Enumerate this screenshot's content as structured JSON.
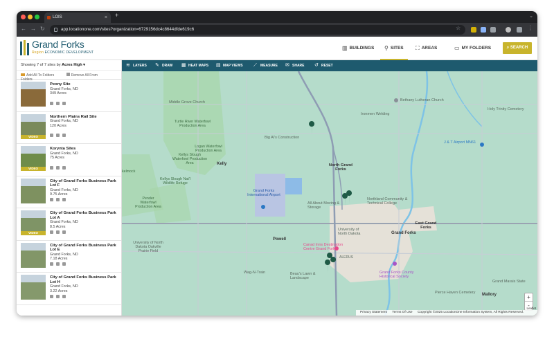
{
  "browser": {
    "tab_title": "LOIS",
    "url": "app.locationone.com/sites?organization=6729156dc4c8644dfde619c6",
    "new_tab": "+",
    "tab_close": "×"
  },
  "brand": {
    "title": "Grand Forks",
    "subtitle_region": "Region",
    "subtitle_rest": "ECONOMIC DEVELOPMENT"
  },
  "topnav": {
    "buildings": "BUILDINGS",
    "sites": "SITES",
    "areas": "AREAS",
    "folders": "MY FOLDERS",
    "search": "SEARCH"
  },
  "sidebar": {
    "showing_prefix": "Showing 7 of 7 sites by",
    "sort": "Acres High ▾",
    "add_all": "Add All To Folders",
    "remove_all": "Remove All From Folders",
    "video_label": "VIDEO",
    "sites": [
      {
        "name": "Peony Site",
        "location": "Grand Forks, ND",
        "acres": "349 Acres",
        "video": false,
        "ground": "#8a6a3a"
      },
      {
        "name": "Northern Plains Rail Site",
        "location": "Grand Forks, ND",
        "acres": "120 Acres",
        "video": true,
        "ground": "#7a8a5a"
      },
      {
        "name": "Korynta Sites",
        "location": "Grand Forks, ND",
        "acres": "75 Acres",
        "video": true,
        "ground": "#6f8c4a"
      },
      {
        "name": "City of Grand Forks Business Park Lot F",
        "location": "Grand Forks, ND",
        "acres": "9.75 Acres",
        "video": false,
        "ground": "#7e9160"
      },
      {
        "name": "City of Grand Forks Business Park Lot A",
        "location": "Grand Forks, ND",
        "acres": "8.5 Acres",
        "video": true,
        "ground": "#7f9466"
      },
      {
        "name": "City of Grand Forks Business Park Lot E",
        "location": "Grand Forks, ND",
        "acres": "7.18 Acres",
        "video": false,
        "ground": "#829668"
      },
      {
        "name": "City of Grand Forks Business Park Lot H",
        "location": "Grand Forks, ND",
        "acres": "3.22 Acres",
        "video": false,
        "ground": "#85996c"
      }
    ]
  },
  "toolbar": {
    "layers": "LAYERS",
    "draw": "DRAW",
    "heat_maps": "HEAT MAPS",
    "map_views": "MAP VIEWS",
    "measure": "MEASURE",
    "share": "SHARE",
    "reset": "RESET"
  },
  "map": {
    "labels": {
      "middle_grove": "Middle Grove Church",
      "bethany": "Bethany Lutheran Church",
      "ironmen": "Ironmen Welding",
      "holy_trinity": "Holy Trinity Cemetery",
      "turtle_river": "Turtle River Waterfowl Production Area",
      "logan": "Logan Waterfowl Production Area",
      "big_al": "Big Al's Construction",
      "jj_airport": "J & T Airport MN61",
      "kellys_slough_wpa": "Kellys Slough Waterfowl Production Area",
      "kelly": "Kelly",
      "north_grand_forks": "North Grand Forks",
      "kellys_slough_refuge": "Kellys Slough Nat'l Wildlife Refuge",
      "gf_airport": "Grand Forks International Airport",
      "all_about": "All About Moving & Storage",
      "northland": "Northland Community & Technical College",
      "pender": "Pender Waterfowl Production Area",
      "east_grand_forks": "East Grand Forks",
      "und": "University of North Dakota",
      "grand_forks": "Grand Forks",
      "powell": "Powell",
      "und_oakville": "University of North Dakota Oakville Prairie Field",
      "canad_inns": "Canad Inns Destination Centre Grand Forks",
      "alerus": "ALERUS",
      "waghntrain": "Wag-N-Train",
      "beaus": "Beau's Lawn & Landscape",
      "gf_historical": "Grand Forks County Historical Society",
      "grand_marais": "Grand Marais State",
      "pierce_haven": "Pierce Haven Cemetery",
      "mallory": "Mallory",
      "kelmock": "kelmock"
    },
    "zoom_in": "+",
    "zoom_out": "-",
    "attribution": "Leaflet"
  },
  "footer": {
    "privacy": "Privacy Statement",
    "terms": "Terms Of Use",
    "copyright": "Copyright ©2025 LocationOne Information System, All Rights Reserved."
  },
  "colors": {
    "teal": "#1e5a6e",
    "gold": "#c8b42c",
    "map_bg": "#b5dccb",
    "pin": "#1f5a46"
  }
}
